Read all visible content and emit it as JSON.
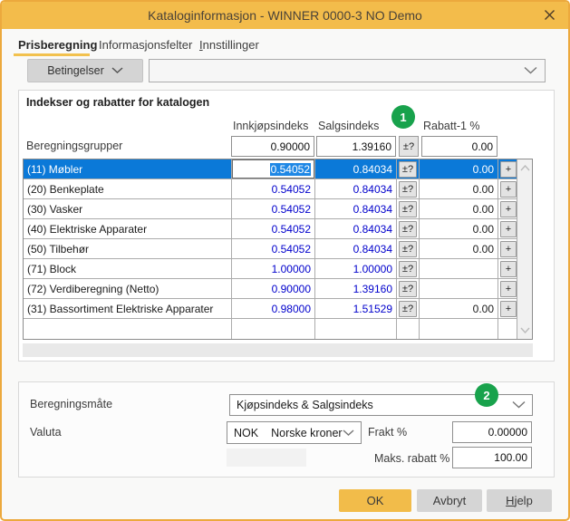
{
  "window": {
    "title": "Kataloginformasjon - WINNER 0000-3 NO Demo"
  },
  "tabs": {
    "prisberegning": "Prisberegning",
    "informasjonsfelter": "Informasjonsfelter",
    "innstillinger_mnemonic": "I",
    "innstillinger_rest": "nnstillinger"
  },
  "toolbar": {
    "betingelser": "Betingelser",
    "filter_value": ""
  },
  "catalog_section": {
    "heading": "Indekser og rabatter for katalogen",
    "col_innkjopsindeks": "Innkjøpsindeks",
    "col_salgsindeks": "Salgsindeks",
    "col_rabatt": "Rabatt-1 %",
    "badge_1": "1",
    "summary": {
      "label": "Beregningsgrupper",
      "innkjop": "0.90000",
      "salgs": "1.39160",
      "pm": "±?",
      "rabatt": "0.00"
    },
    "rows": [
      {
        "name": "(11) Møbler",
        "innkjop": "0.54052",
        "salgs": "0.84034",
        "pm": "±?",
        "rabatt": "0.00",
        "plus": "+"
      },
      {
        "name": "(20) Benkeplate",
        "innkjop": "0.54052",
        "salgs": "0.84034",
        "pm": "±?",
        "rabatt": "0.00",
        "plus": "+"
      },
      {
        "name": "(30) Vasker",
        "innkjop": "0.54052",
        "salgs": "0.84034",
        "pm": "±?",
        "rabatt": "0.00",
        "plus": "+"
      },
      {
        "name": "(40) Elektriske Apparater",
        "innkjop": "0.54052",
        "salgs": "0.84034",
        "pm": "±?",
        "rabatt": "0.00",
        "plus": "+"
      },
      {
        "name": "(50) Tilbehør",
        "innkjop": "0.54052",
        "salgs": "0.84034",
        "pm": "±?",
        "rabatt": "0.00",
        "plus": "+"
      },
      {
        "name": "(71) Block",
        "innkjop": "1.00000",
        "salgs": "1.00000",
        "pm": "±?",
        "rabatt": "",
        "plus": "+"
      },
      {
        "name": "(72) Verdiberegning (Netto)",
        "innkjop": "0.90000",
        "salgs": "1.39160",
        "pm": "±?",
        "rabatt": "",
        "plus": "+"
      },
      {
        "name": "(31) Bassortiment Elektriske Apparater",
        "innkjop": "0.98000",
        "salgs": "1.51529",
        "pm": "±?",
        "rabatt": "0.00",
        "plus": "+"
      },
      {
        "name": "",
        "innkjop": "",
        "salgs": "",
        "pm": "",
        "rabatt": "",
        "plus": ""
      }
    ]
  },
  "settings_section": {
    "badge_2": "2",
    "beregningsmate_label": "Beregningsmåte",
    "beregningsmate_value": "Kjøpsindeks & Salgsindeks",
    "valuta_label": "Valuta",
    "valuta_code": "NOK",
    "valuta_name": "Norske kroner",
    "frakt_label": "Frakt %",
    "frakt_value": "0.00000",
    "maks_rabatt_label": "Maks. rabatt %",
    "maks_rabatt_value": "100.00"
  },
  "footer": {
    "ok": "OK",
    "avbryt": "Avbryt",
    "hjelp_mnemonic": "H",
    "hjelp_rest": "jelp"
  },
  "colors": {
    "accent_orange": "#F3BC4B",
    "selection_blue": "#0B79D8",
    "badge_green": "#18A24C",
    "value_blue": "#0000CC"
  }
}
